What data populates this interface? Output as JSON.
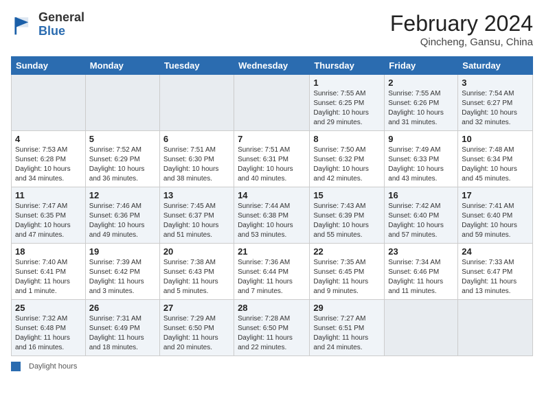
{
  "header": {
    "logo_general": "General",
    "logo_blue": "Blue",
    "month_title": "February 2024",
    "location": "Qincheng, Gansu, China"
  },
  "weekdays": [
    "Sunday",
    "Monday",
    "Tuesday",
    "Wednesday",
    "Thursday",
    "Friday",
    "Saturday"
  ],
  "weeks": [
    [
      {
        "day": "",
        "info": ""
      },
      {
        "day": "",
        "info": ""
      },
      {
        "day": "",
        "info": ""
      },
      {
        "day": "",
        "info": ""
      },
      {
        "day": "1",
        "info": "Sunrise: 7:55 AM\nSunset: 6:25 PM\nDaylight: 10 hours\nand 29 minutes."
      },
      {
        "day": "2",
        "info": "Sunrise: 7:55 AM\nSunset: 6:26 PM\nDaylight: 10 hours\nand 31 minutes."
      },
      {
        "day": "3",
        "info": "Sunrise: 7:54 AM\nSunset: 6:27 PM\nDaylight: 10 hours\nand 32 minutes."
      }
    ],
    [
      {
        "day": "4",
        "info": "Sunrise: 7:53 AM\nSunset: 6:28 PM\nDaylight: 10 hours\nand 34 minutes."
      },
      {
        "day": "5",
        "info": "Sunrise: 7:52 AM\nSunset: 6:29 PM\nDaylight: 10 hours\nand 36 minutes."
      },
      {
        "day": "6",
        "info": "Sunrise: 7:51 AM\nSunset: 6:30 PM\nDaylight: 10 hours\nand 38 minutes."
      },
      {
        "day": "7",
        "info": "Sunrise: 7:51 AM\nSunset: 6:31 PM\nDaylight: 10 hours\nand 40 minutes."
      },
      {
        "day": "8",
        "info": "Sunrise: 7:50 AM\nSunset: 6:32 PM\nDaylight: 10 hours\nand 42 minutes."
      },
      {
        "day": "9",
        "info": "Sunrise: 7:49 AM\nSunset: 6:33 PM\nDaylight: 10 hours\nand 43 minutes."
      },
      {
        "day": "10",
        "info": "Sunrise: 7:48 AM\nSunset: 6:34 PM\nDaylight: 10 hours\nand 45 minutes."
      }
    ],
    [
      {
        "day": "11",
        "info": "Sunrise: 7:47 AM\nSunset: 6:35 PM\nDaylight: 10 hours\nand 47 minutes."
      },
      {
        "day": "12",
        "info": "Sunrise: 7:46 AM\nSunset: 6:36 PM\nDaylight: 10 hours\nand 49 minutes."
      },
      {
        "day": "13",
        "info": "Sunrise: 7:45 AM\nSunset: 6:37 PM\nDaylight: 10 hours\nand 51 minutes."
      },
      {
        "day": "14",
        "info": "Sunrise: 7:44 AM\nSunset: 6:38 PM\nDaylight: 10 hours\nand 53 minutes."
      },
      {
        "day": "15",
        "info": "Sunrise: 7:43 AM\nSunset: 6:39 PM\nDaylight: 10 hours\nand 55 minutes."
      },
      {
        "day": "16",
        "info": "Sunrise: 7:42 AM\nSunset: 6:40 PM\nDaylight: 10 hours\nand 57 minutes."
      },
      {
        "day": "17",
        "info": "Sunrise: 7:41 AM\nSunset: 6:40 PM\nDaylight: 10 hours\nand 59 minutes."
      }
    ],
    [
      {
        "day": "18",
        "info": "Sunrise: 7:40 AM\nSunset: 6:41 PM\nDaylight: 11 hours\nand 1 minute."
      },
      {
        "day": "19",
        "info": "Sunrise: 7:39 AM\nSunset: 6:42 PM\nDaylight: 11 hours\nand 3 minutes."
      },
      {
        "day": "20",
        "info": "Sunrise: 7:38 AM\nSunset: 6:43 PM\nDaylight: 11 hours\nand 5 minutes."
      },
      {
        "day": "21",
        "info": "Sunrise: 7:36 AM\nSunset: 6:44 PM\nDaylight: 11 hours\nand 7 minutes."
      },
      {
        "day": "22",
        "info": "Sunrise: 7:35 AM\nSunset: 6:45 PM\nDaylight: 11 hours\nand 9 minutes."
      },
      {
        "day": "23",
        "info": "Sunrise: 7:34 AM\nSunset: 6:46 PM\nDaylight: 11 hours\nand 11 minutes."
      },
      {
        "day": "24",
        "info": "Sunrise: 7:33 AM\nSunset: 6:47 PM\nDaylight: 11 hours\nand 13 minutes."
      }
    ],
    [
      {
        "day": "25",
        "info": "Sunrise: 7:32 AM\nSunset: 6:48 PM\nDaylight: 11 hours\nand 16 minutes."
      },
      {
        "day": "26",
        "info": "Sunrise: 7:31 AM\nSunset: 6:49 PM\nDaylight: 11 hours\nand 18 minutes."
      },
      {
        "day": "27",
        "info": "Sunrise: 7:29 AM\nSunset: 6:50 PM\nDaylight: 11 hours\nand 20 minutes."
      },
      {
        "day": "28",
        "info": "Sunrise: 7:28 AM\nSunset: 6:50 PM\nDaylight: 11 hours\nand 22 minutes."
      },
      {
        "day": "29",
        "info": "Sunrise: 7:27 AM\nSunset: 6:51 PM\nDaylight: 11 hours\nand 24 minutes."
      },
      {
        "day": "",
        "info": ""
      },
      {
        "day": "",
        "info": ""
      }
    ]
  ],
  "footer": {
    "legend_label": "Daylight hours"
  }
}
